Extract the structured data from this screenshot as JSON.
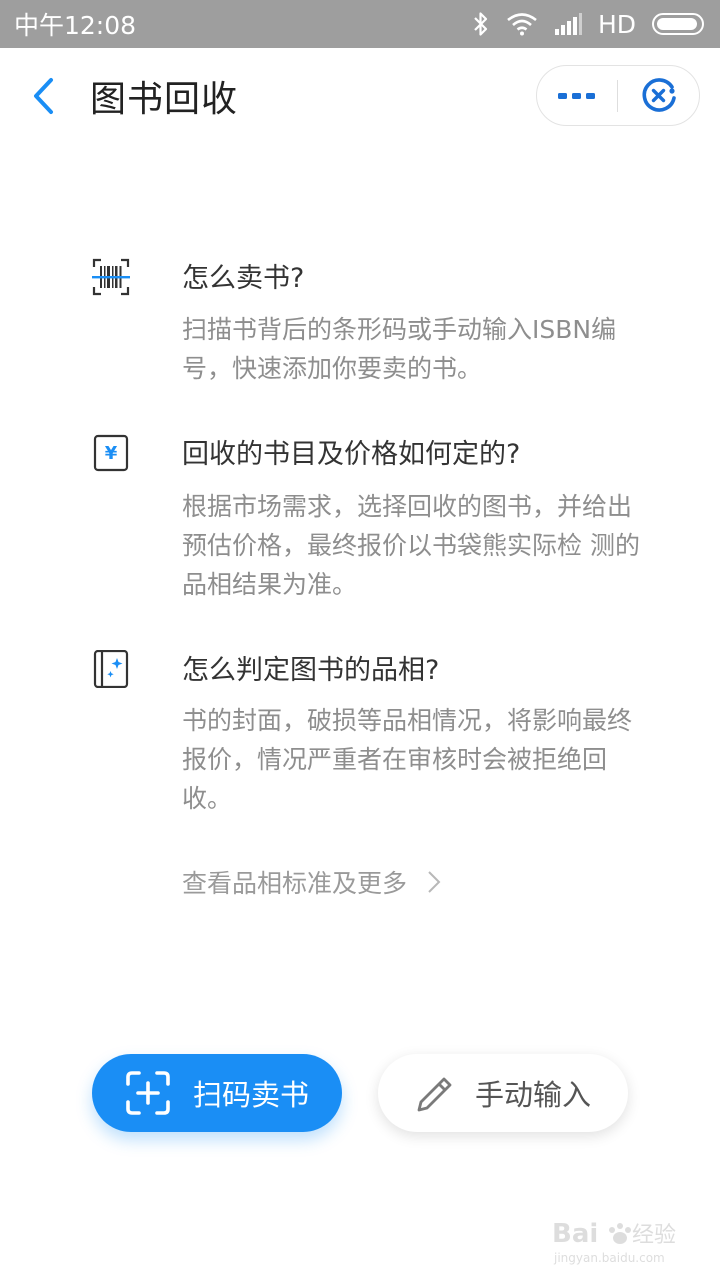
{
  "status_bar": {
    "carrier_time": "中午12:08",
    "network": "HD",
    "icons": [
      "bluetooth-icon",
      "wifi-icon",
      "signal-icon",
      "battery-icon"
    ]
  },
  "nav": {
    "title": "图书回收",
    "back_icon": "chevron-left-icon",
    "more_icon": "more-dots-icon",
    "close_icon": "close-target-icon"
  },
  "faq": [
    {
      "icon": "barcode-scan-icon",
      "question": "怎么卖书?",
      "answer": "扫描书背后的条形码或手动输入ISBN编号，快速添加你要卖的书。"
    },
    {
      "icon": "yen-price-icon",
      "question": "回收的书目及价格如何定的?",
      "answer": "根据市场需求，选择回收的图书，并给出预估价格，最终报价以书袋熊实际检 测的品相结果为准。"
    },
    {
      "icon": "book-quality-icon",
      "question": "怎么判定图书的品相?",
      "answer": "书的封面，破损等品相情况，将影响最终报价，情况严重者在审核时会被拒绝回收。"
    }
  ],
  "more_link": "查看品相标准及更多",
  "actions": {
    "scan_label": "扫码卖书",
    "manual_label": "手动输入"
  },
  "colors": {
    "accent": "#1a8ef5",
    "status_bar": "#9e9e9e",
    "answer_text": "#8e8e8e"
  },
  "watermark": {
    "brand": "Baidu经验",
    "url": "jingyan.baidu.com"
  }
}
